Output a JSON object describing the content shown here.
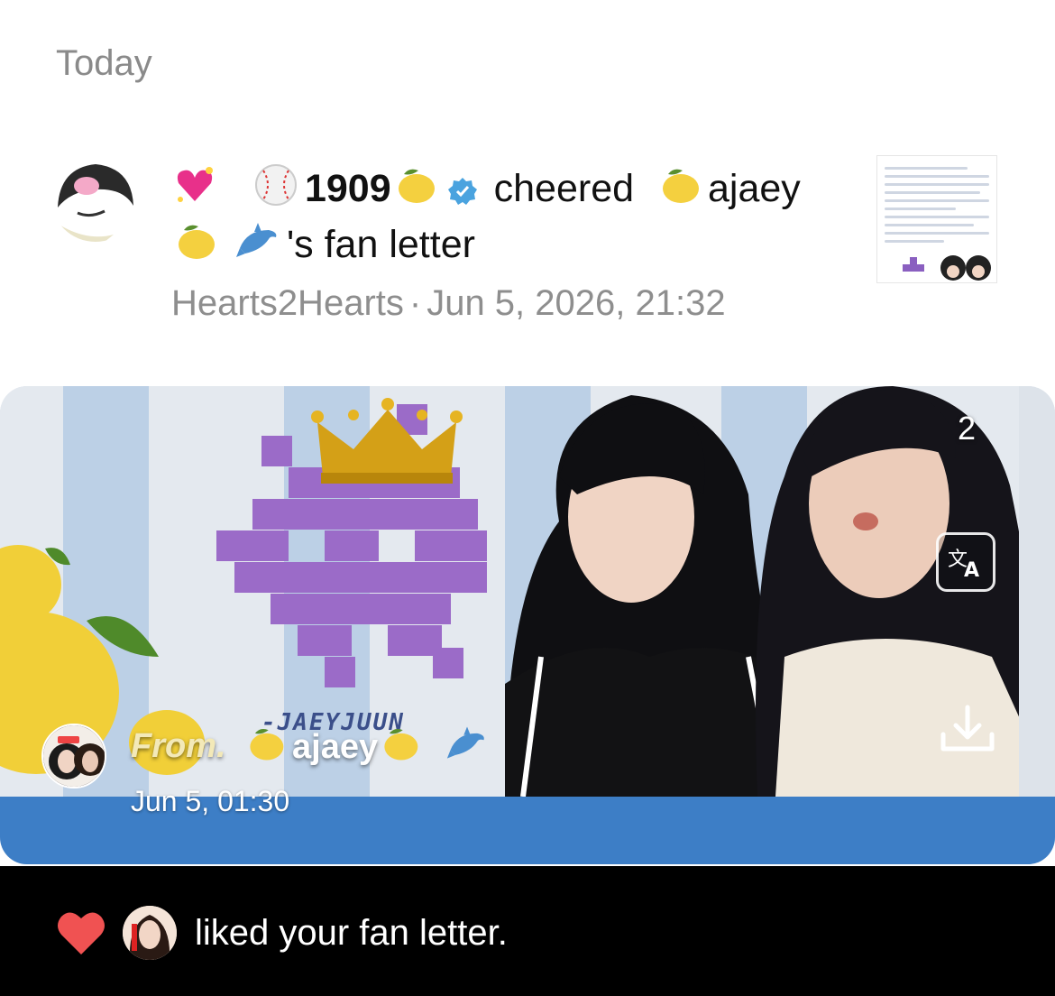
{
  "section": {
    "label": "Today"
  },
  "notification": {
    "user_handle": "1909",
    "action": "cheered",
    "target_name": "ajaey",
    "suffix": "'s fan letter",
    "community": "Hearts2Hearts",
    "separator": "·",
    "timestamp": "Jun 5, 2026, 21:32",
    "icons": [
      "sparkling-heart-icon",
      "baseball-icon",
      "lemon-icon",
      "verified-badge-icon",
      "lemon-icon",
      "lemon-icon",
      "dolphin-icon"
    ]
  },
  "card": {
    "page_count": "2",
    "signature": "-JAEYJUUN",
    "from_label": "From.",
    "from_name": "ajaey",
    "from_date": "Jun 5, 01:30",
    "icons": [
      "translate-icon",
      "download-icon"
    ]
  },
  "like_notification": {
    "text": "liked your fan letter.",
    "icons": [
      "heart-icon"
    ]
  },
  "colors": {
    "accent_verified": "#4aa3df",
    "card_band": "#3d7ec6",
    "heart": "#f05252",
    "muted_text": "#8e8e8e"
  }
}
